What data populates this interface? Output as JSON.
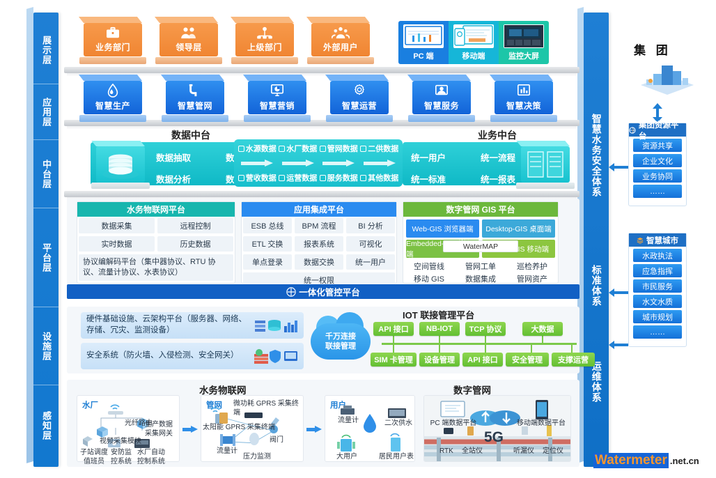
{
  "layers_left": [
    "展示层",
    "应用层",
    "中台层",
    "平台层",
    "设施层",
    "感知层"
  ],
  "rail_right": [
    "智慧水务安全体系",
    "标准体系",
    "运维体系"
  ],
  "display_layer": {
    "blocks": [
      {
        "label": "业务部门",
        "icon": "briefcase-icon"
      },
      {
        "label": "领导层",
        "icon": "leaders-icon"
      },
      {
        "label": "上级部门",
        "icon": "org-chart-icon"
      },
      {
        "label": "外部用户",
        "icon": "users-group-icon"
      }
    ],
    "devices": [
      {
        "label": "PC 端",
        "icon": "desktop-icon"
      },
      {
        "label": "移动端",
        "icon": "mobile-icon"
      },
      {
        "label": "监控大屏",
        "icon": "control-screen-icon"
      }
    ]
  },
  "app_layer": {
    "blocks": [
      {
        "label": "智慧生产",
        "icon": "water-drop-icon"
      },
      {
        "label": "智慧管网",
        "icon": "pipe-icon"
      },
      {
        "label": "智慧营销",
        "icon": "monitor-chart-icon"
      },
      {
        "label": "智慧运营",
        "icon": "gear-icon"
      },
      {
        "label": "智慧服务",
        "icon": "service-icon"
      },
      {
        "label": "智慧决策",
        "icon": "bar-chart-icon"
      }
    ]
  },
  "middle_layer": {
    "data_platform": {
      "title": "数据中台",
      "icon": "database-stack-icon",
      "capabilities": [
        "数据抽取",
        "数据清洗",
        "数据分析",
        "数据决策"
      ],
      "tags_top": [
        "水源数据",
        "水厂数据",
        "管网数据",
        "二供数据"
      ],
      "tags_bottom": [
        "营收数据",
        "运营数据",
        "服务数据",
        "其他数据"
      ]
    },
    "business_platform": {
      "title": "业务中台",
      "icon": "books-icon",
      "capabilities": [
        "统一用户",
        "统一流程",
        "统一标准",
        "统一报表"
      ]
    }
  },
  "platform_layer": {
    "iot_platform": {
      "title": "水务物联网平台",
      "color": "#17b6ae",
      "cells": [
        "数据采集",
        "远程控制",
        "实时数据",
        "历史数据"
      ],
      "wide_cell": "协议编解码平台（集中器协议、RTU 协议、流量计协议、水表协议）"
    },
    "integration_platform": {
      "title": "应用集成平台",
      "color": "#2a8bf0",
      "rows": [
        [
          "ESB 总线",
          "BPM 流程",
          "BI 分析"
        ],
        [
          "ETL 交换",
          "报表系统",
          "可视化"
        ],
        [
          "单点登录",
          "数据交换",
          "统一用户"
        ]
      ],
      "full_cell": "统一权限"
    },
    "gis_platform": {
      "title": "数字管网 GIS 平台",
      "color": "#6cb83c",
      "quad": [
        {
          "label": "Web-GIS 浏览器端",
          "color": "#2a8bf0"
        },
        {
          "label": "Desktop-GIS 桌面端",
          "color": "#3ca9d9"
        },
        {
          "label": "Embedded-GIS 嵌入端",
          "color": "#7cc144"
        },
        {
          "label": "Mobile-GIS 移动端",
          "color": "#8cc63f"
        }
      ],
      "center_badge": "WaterMAP",
      "footer": [
        [
          "空间管线",
          "管网工单",
          "巡检养护"
        ],
        [
          "移动 GIS",
          "数据集成",
          "管网资产"
        ]
      ]
    },
    "integrated_control_bar": {
      "label": "一体化管控平台",
      "icon": "hub-icon"
    }
  },
  "facility_layer": {
    "bars": [
      "硬件基础设施、云架构平台（服务器、网络、存储、冗灾、监测设备）",
      "安全系统（防火墙、入侵检测、安全网关）"
    ],
    "cloud_tag": [
      "千万连接",
      "联接管理"
    ],
    "iot_title": "IOT 联接管理平台",
    "top_buttons": [
      "API 接口",
      "NB-IOT",
      "TCP 协议",
      "大数据"
    ],
    "bottom_buttons": [
      "SIM 卡管理",
      "设备管理",
      "API 接口",
      "安全管理",
      "支撑运营"
    ]
  },
  "perception_layer": {
    "groups": [
      {
        "title": "水务物联网",
        "panels": [
          {
            "tag": "水厂",
            "labels": [
              "光纤路由",
              "生产数据采集网关",
              "视频采集模块",
              "子站调度值班员",
              "安防监控系统",
              "水厂自动控制系统"
            ]
          },
          {
            "tag": "管网",
            "labels": [
              "微功耗 GPRS 采集终端",
              "太阳能 GPRS 采集终端",
              "阀门",
              "流量计",
              "压力监测"
            ]
          },
          {
            "tag": "用户",
            "labels": [
              "流量计",
              "二次供水",
              "大用户",
              "居民用户表"
            ]
          }
        ]
      },
      {
        "title": "数字管网",
        "panels": [
          {
            "tag": "",
            "labels": [
              "PC 端数据平台",
              "移动端数据平台",
              "5G",
              "RTK",
              "全站仪",
              "听漏仪",
              "定位仪"
            ]
          }
        ]
      }
    ]
  },
  "right_column": {
    "group_title": "集 团",
    "group_icon": "city-isometric-icon",
    "resource_panel": {
      "title": "集团资源平台",
      "icon": "globe-icon",
      "items": [
        "资源共享",
        "企业文化",
        "业务协同",
        "……"
      ]
    },
    "smart_city_panel": {
      "title": "智慧城市",
      "icon": "layers-icon",
      "items": [
        "水政执法",
        "应急指挥",
        "市民服务",
        "水文水质",
        "城市规划",
        "……"
      ]
    }
  },
  "watermark": {
    "brand": "Watermeter",
    "domain": ".net.cn"
  }
}
